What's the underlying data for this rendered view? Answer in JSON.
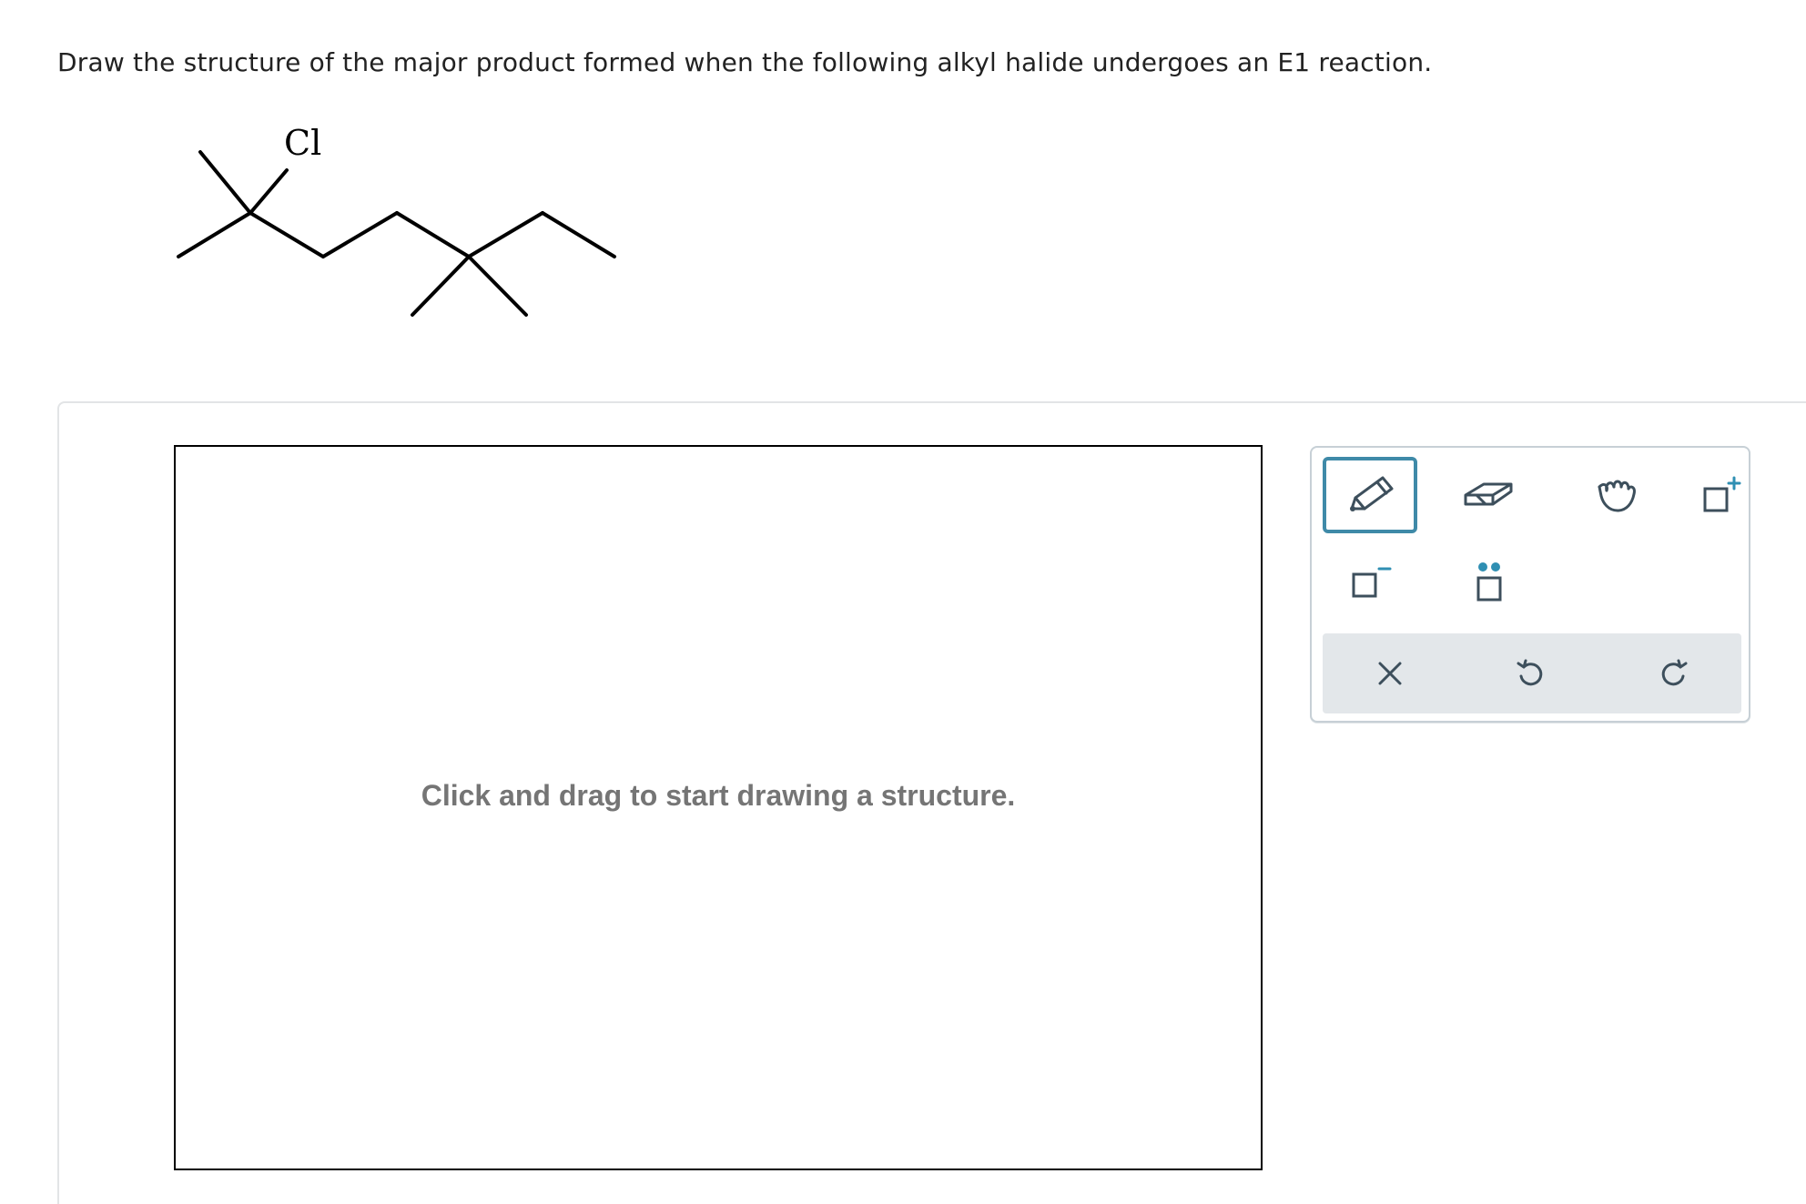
{
  "question": {
    "text": "Draw the structure of the major product formed when the following alkyl halide undergoes an E1 reaction."
  },
  "molecule": {
    "halogen_label": "Cl"
  },
  "canvas": {
    "hint": "Click and drag to start drawing a structure."
  },
  "toolbar": {
    "tools": [
      {
        "name": "pencil-icon",
        "selected": true
      },
      {
        "name": "eraser-icon",
        "selected": false
      },
      {
        "name": "hand-icon",
        "selected": false
      },
      {
        "name": "positive-charge-icon",
        "selected": false
      },
      {
        "name": "negative-charge-icon",
        "selected": false
      },
      {
        "name": "lone-pair-icon",
        "selected": false
      }
    ],
    "actions": [
      "close-icon",
      "undo-icon",
      "redo-icon"
    ]
  },
  "colors": {
    "accent": "#3f8aa8",
    "icon": "#3d4f5c",
    "hint_text": "#757575",
    "action_bar": "#e3e7ea"
  }
}
